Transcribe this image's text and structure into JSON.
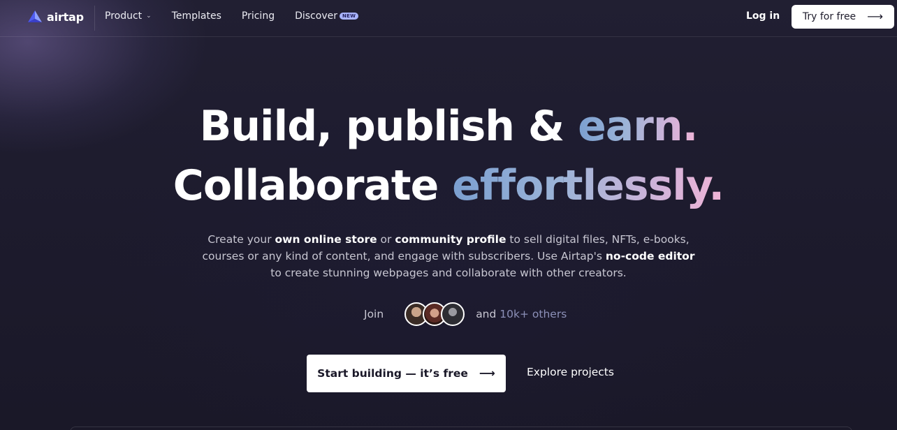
{
  "brand": {
    "name": "airtap",
    "logo_icon": "airtap-logo-icon"
  },
  "nav": {
    "links": [
      {
        "label": "Product",
        "has_dropdown": true
      },
      {
        "label": "Templates"
      },
      {
        "label": "Pricing"
      },
      {
        "label": "Discover",
        "badge": "NEW"
      }
    ],
    "login_label": "Log in",
    "cta_label": "Try for free",
    "cta_icon": "arrow-right-icon"
  },
  "hero": {
    "line1_plain": "Build, publish & ",
    "line1_accent": "earn.",
    "line2_plain": "Collaborate ",
    "line2_accent": "effortlessly.",
    "desc": {
      "l1_a": "Create your ",
      "l1_b": "own online store",
      "l1_c": " or ",
      "l1_d": "community profile",
      "l1_e": " to sell digital files, NFTs, e-books,",
      "l2_a": "courses or any kind of content, and engage with subscribers. Use Airtap's ",
      "l2_b": "no-code editor",
      "l3": "to create stunning webpages and collaborate with other creators."
    },
    "join_label": "Join",
    "others_prefix": "and ",
    "others_count": "10k+ others",
    "primary_cta": "Start building — it’s free",
    "secondary_cta": "Explore projects"
  },
  "colors": {
    "background": "#1c1a2b",
    "accent_gradient_start": "#7b9fd0",
    "accent_gradient_end": "#f0b5d7",
    "badge": "#a9b4ff"
  }
}
